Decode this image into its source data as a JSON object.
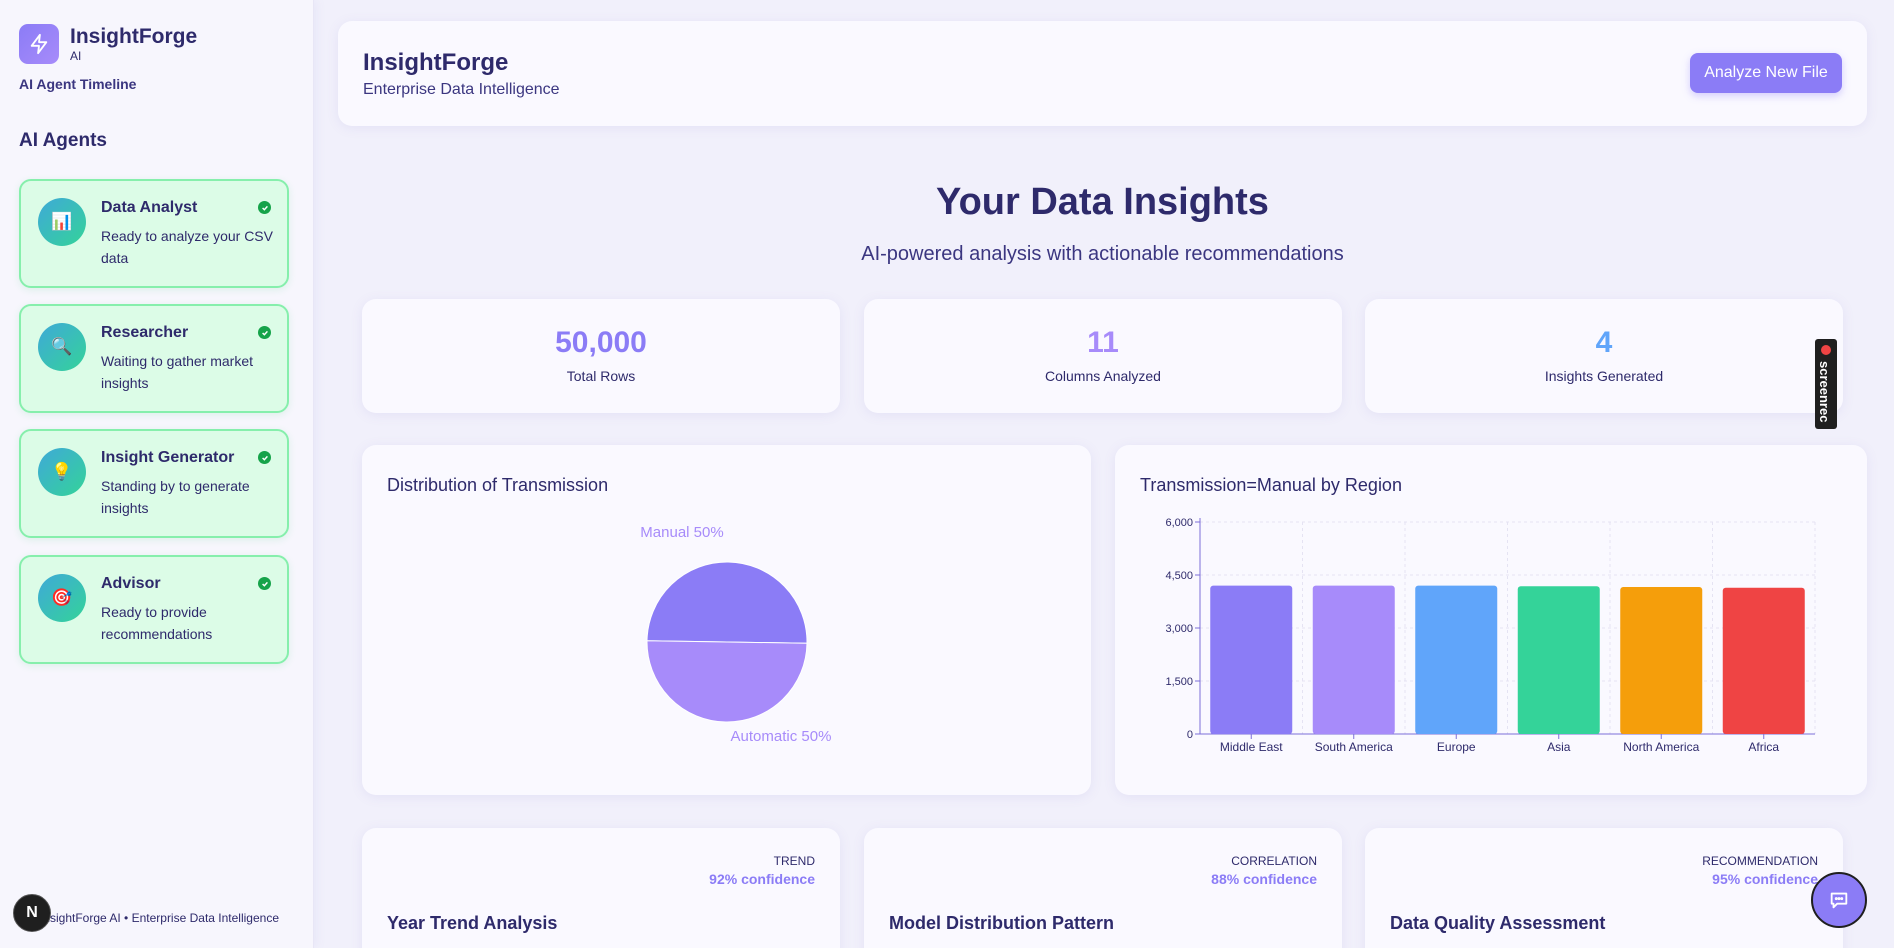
{
  "sidebar": {
    "brand_name": "InsightForge",
    "brand_suffix": "AI",
    "brand_sub": "AI Agent Timeline",
    "agents_title": "AI Agents",
    "agents": [
      {
        "name": "Data Analyst",
        "desc": "Ready to analyze your CSV data",
        "icon": "📊",
        "status": "ready"
      },
      {
        "name": "Researcher",
        "desc": "Waiting to gather market insights",
        "icon": "🔍",
        "status": "ready"
      },
      {
        "name": "Insight Generator",
        "desc": "Standing by to generate insights",
        "icon": "💡",
        "status": "ready"
      },
      {
        "name": "Advisor",
        "desc": "Ready to provide recommendations",
        "icon": "🎯",
        "status": "ready"
      }
    ],
    "footer": "InsightForge AI • Enterprise Data Intelligence",
    "n_badge": "N"
  },
  "header": {
    "title": "InsightForge",
    "subtitle": "Enterprise Data Intelligence",
    "analyze_button": "Analyze New File"
  },
  "hero": {
    "title": "Your Data Insights",
    "subtitle": "AI-powered analysis with actionable recommendations"
  },
  "stats": [
    {
      "value": "50,000",
      "label": "Total Rows",
      "color": "#8b7cf6"
    },
    {
      "value": "11",
      "label": "Columns Analyzed",
      "color": "#a78bfa"
    },
    {
      "value": "4",
      "label": "Insights Generated",
      "color": "#60a5fa"
    }
  ],
  "chart_data": [
    {
      "type": "pie",
      "title": "Distribution of Transmission",
      "labels": [
        "Manual",
        "Automatic"
      ],
      "values": [
        50,
        50
      ],
      "slice_labels": [
        "Manual 50%",
        "Automatic 50%"
      ],
      "colors": [
        "#8b7cf6",
        "#a78bfa"
      ]
    },
    {
      "type": "bar",
      "title": "Transmission=Manual by Region",
      "categories": [
        "Middle East",
        "South America",
        "Europe",
        "Asia",
        "North America",
        "Africa"
      ],
      "values": [
        4200,
        4200,
        4200,
        4180,
        4160,
        4140
      ],
      "colors": [
        "#8b7cf6",
        "#a78bfa",
        "#60a5fa",
        "#34d399",
        "#f59e0b",
        "#ef4444"
      ],
      "ylim": [
        0,
        6000
      ],
      "yticks": [
        "0",
        "1,500",
        "3,000",
        "4,500",
        "6,000"
      ],
      "ytick_values": [
        0,
        1500,
        3000,
        4500,
        6000
      ],
      "grid": true
    }
  ],
  "insights": [
    {
      "type": "TREND",
      "confidence": "92% confidence",
      "title": "Year Trend Analysis"
    },
    {
      "type": "CORRELATION",
      "confidence": "88% confidence",
      "title": "Model Distribution Pattern"
    },
    {
      "type": "RECOMMENDATION",
      "confidence": "95% confidence",
      "title": "Data Quality Assessment"
    }
  ],
  "overlay": {
    "screenrec_label": "screenrec"
  }
}
